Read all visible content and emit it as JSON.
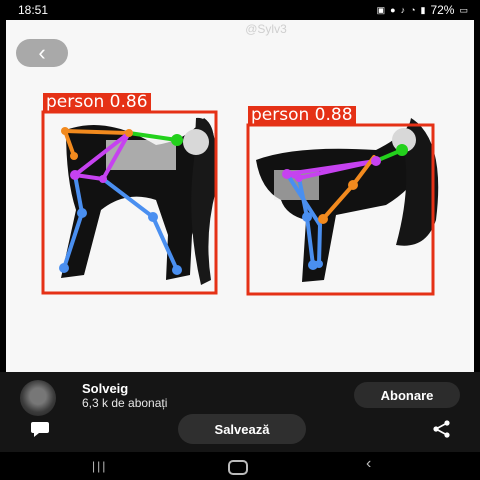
{
  "status_bar": {
    "time": "18:51",
    "icons": [
      "photo-icon",
      "chat-icon",
      "volume-icon",
      "wifi-icon",
      "signal-icon",
      "battery-icon"
    ],
    "battery": "72%"
  },
  "top": {
    "faded_title": "@Sylv3"
  },
  "detections": [
    {
      "label": "person 0.86",
      "color": "#e53116"
    },
    {
      "label": "person 0.88",
      "color": "#e53116"
    }
  ],
  "channel": {
    "name": "Solveig",
    "subscribers": "6,3 k de abonați"
  },
  "actions": {
    "subscribe": "Abonare",
    "save": "Salvează"
  },
  "navigation": [
    "recents-icon",
    "home-icon",
    "back-icon"
  ],
  "colors": {
    "box": "#e53116",
    "limb_orange": "#f28a1e",
    "limb_blue": "#4a8ff0",
    "limb_magenta": "#c642f0",
    "limb_green": "#23d11c"
  }
}
